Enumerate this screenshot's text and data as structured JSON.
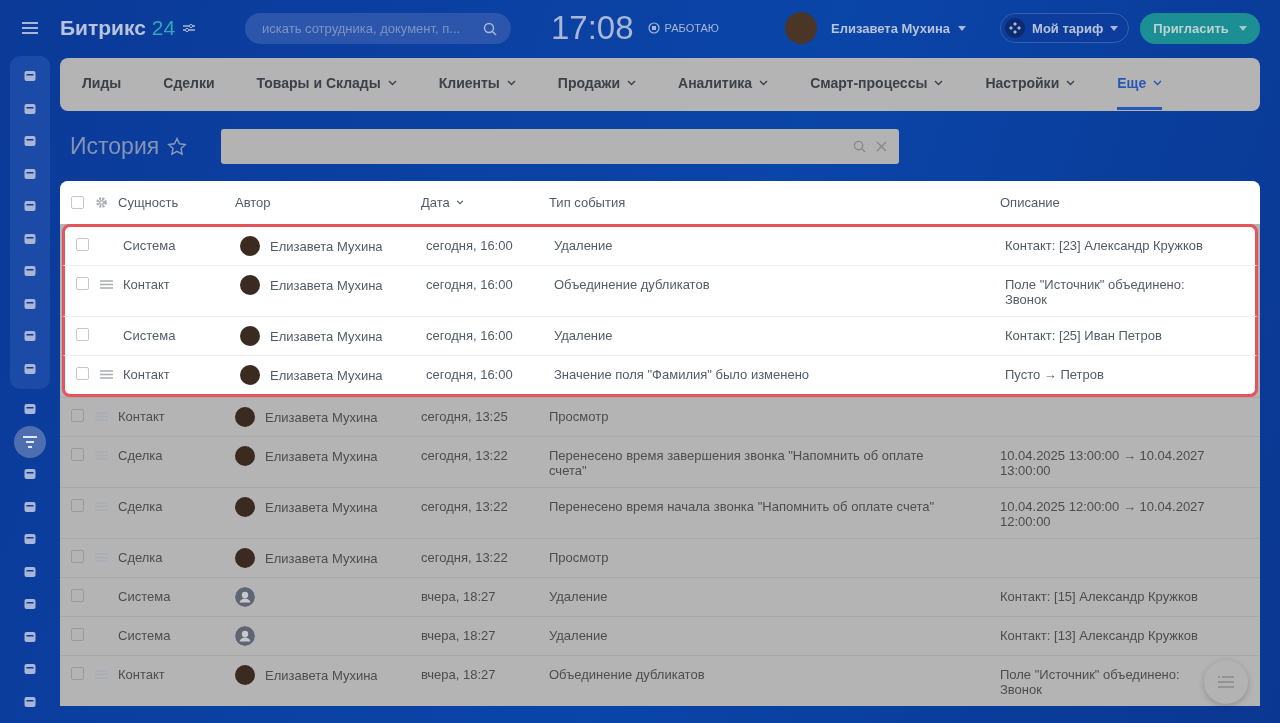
{
  "header": {
    "logo": "Битрикс",
    "logo_number": "24",
    "search": {
      "placeholder": "искать сотрудника, документ, п..."
    },
    "clock": "17:08",
    "work_status": "РАБОТАЮ",
    "user": {
      "name": "Елизавета Мухина"
    },
    "tariff_button": "Мой тариф",
    "invite_button": "Пригласить"
  },
  "sidebar": {
    "items": [
      {
        "selected": false
      },
      {
        "selected": false
      },
      {
        "selected": false
      },
      {
        "selected": false
      },
      {
        "selected": false
      },
      {
        "selected": false
      },
      {
        "selected": false
      },
      {
        "selected": false
      },
      {
        "selected": false
      },
      {
        "selected": false
      },
      {
        "selected": false
      },
      {
        "selected": true
      },
      {
        "selected": false
      },
      {
        "selected": false
      },
      {
        "selected": false
      },
      {
        "selected": false
      },
      {
        "selected": false
      },
      {
        "selected": false
      },
      {
        "selected": false
      },
      {
        "selected": false
      }
    ]
  },
  "nav": {
    "items": [
      {
        "label": "Лиды",
        "dropdown": false,
        "selected": false
      },
      {
        "label": "Сделки",
        "dropdown": false,
        "selected": false
      },
      {
        "label": "Товары и Склады",
        "dropdown": true,
        "selected": false
      },
      {
        "label": "Клиенты",
        "dropdown": true,
        "selected": false
      },
      {
        "label": "Продажи",
        "dropdown": true,
        "selected": false
      },
      {
        "label": "Аналитика",
        "dropdown": true,
        "selected": false
      },
      {
        "label": "Смарт-процессы",
        "dropdown": true,
        "selected": false
      },
      {
        "label": "Настройки",
        "dropdown": true,
        "selected": false
      },
      {
        "label": "Еще",
        "dropdown": true,
        "selected": true
      }
    ]
  },
  "page": {
    "title": "История"
  },
  "table": {
    "select_all_checked": false,
    "columns": [
      {
        "label": "Сущность",
        "sorted": false
      },
      {
        "label": "Автор",
        "sorted": false
      },
      {
        "label": "Дата",
        "sorted": true
      },
      {
        "label": "Тип события",
        "sorted": false
      },
      {
        "label": "Описание",
        "sorted": false
      }
    ],
    "rows": [
      {
        "highlighted": true,
        "draggable": false,
        "entity": "Система",
        "kind": "photo",
        "author": "Елизавета Мухина",
        "date": "сегодня, 16:00",
        "event": "Удаление",
        "description": "Контакт: [23] Александр Кружков"
      },
      {
        "highlighted": true,
        "draggable": true,
        "entity": "Контакт",
        "kind": "photo",
        "author": "Елизавета Мухина",
        "date": "сегодня, 16:00",
        "event": "Объединение дубликатов",
        "description": "Поле \"Источник\" объединено: Звонок"
      },
      {
        "highlighted": true,
        "draggable": false,
        "entity": "Система",
        "kind": "photo",
        "author": "Елизавета Мухина",
        "date": "сегодня, 16:00",
        "event": "Удаление",
        "description": "Контакт: [25] Иван Петров"
      },
      {
        "highlighted": true,
        "draggable": true,
        "entity": "Контакт",
        "kind": "photo",
        "author": "Елизавета Мухина",
        "date": "сегодня, 16:00",
        "event": "Значение поля \"Фамилия\" было изменено",
        "description": "Пусто → Петров"
      },
      {
        "highlighted": false,
        "draggable": true,
        "entity": "Контакт",
        "kind": "photo",
        "author": "Елизавета Мухина",
        "date": "сегодня, 13:25",
        "event": "Просмотр"
      },
      {
        "highlighted": false,
        "draggable": true,
        "entity": "Сделка",
        "kind": "photo",
        "author": "Елизавета Мухина",
        "date": "сегодня, 13:22",
        "event": "Перенесено время завершения звонка \"Напомнить об оплате счета\"",
        "description": "10.04.2025 13:00:00 → 10.04.2027 13:00:00"
      },
      {
        "highlighted": false,
        "draggable": true,
        "entity": "Сделка",
        "kind": "photo",
        "author": "Елизавета Мухина",
        "date": "сегодня, 13:22",
        "event": "Перенесено время начала звонка \"Напомнить об оплате счета\"",
        "description": "10.04.2025 12:00:00 → 10.04.2027 12:00:00"
      },
      {
        "highlighted": false,
        "draggable": true,
        "entity": "Сделка",
        "kind": "photo",
        "author": "Елизавета Мухина",
        "date": "сегодня, 13:22",
        "event": "Просмотр"
      },
      {
        "highlighted": false,
        "draggable": false,
        "entity": "Система",
        "kind": "placeholder",
        "date": "вчера, 18:27",
        "event": "Удаление",
        "description": "Контакт: [15] Александр Кружков"
      },
      {
        "highlighted": false,
        "draggable": false,
        "entity": "Система",
        "kind": "placeholder",
        "date": "вчера, 18:27",
        "event": "Удаление",
        "description": "Контакт: [13] Александр Кружков"
      },
      {
        "highlighted": false,
        "draggable": true,
        "entity": "Контакт",
        "kind": "photo",
        "author": "Елизавета Мухина",
        "date": "вчера, 18:27",
        "event": "Объединение дубликатов",
        "description": "Поле \"Источник\" объединено: Звонок"
      }
    ]
  }
}
